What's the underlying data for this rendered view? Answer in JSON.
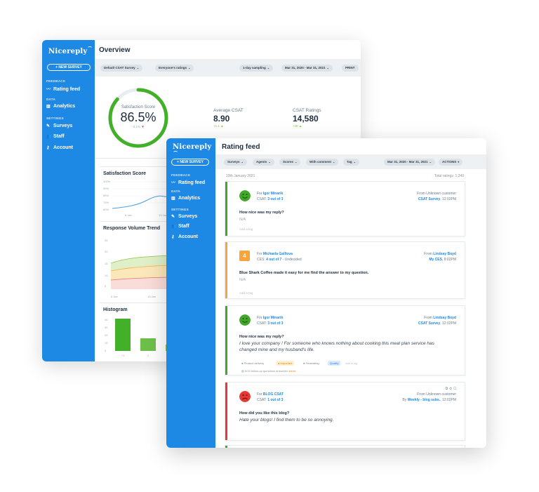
{
  "back": {
    "logo": "Nicereply",
    "new_survey": "+ NEW SURVEY",
    "title": "Overview",
    "sections": {
      "feedback": "FEEDBACK",
      "data": "DATA",
      "settings": "SETTINGS"
    },
    "nav": {
      "rating_feed": "Rating feed",
      "analytics": "Analytics",
      "surveys": "Surveys",
      "staff": "Staff",
      "account": "Account"
    },
    "filters": {
      "survey": "Default CSAT Survey",
      "ratings": "Everyone's ratings",
      "sampling": "1-day sampling",
      "daterange": "Mar 31, 2020 - Mar 31, 2021",
      "print": "PRINT"
    },
    "gauge": {
      "label": "Satisfaction Score",
      "value": "86.5%",
      "delta": "-0.1%",
      "fraction": 0.865
    },
    "kpis": [
      {
        "label": "Average CSAT",
        "value": "8.90",
        "delta": "+1.1"
      },
      {
        "label": "CSAT Ratings",
        "value": "14,580",
        "delta": "+28"
      }
    ],
    "charts": {
      "satisfaction_title": "Satisfaction Score",
      "satisfaction_ticks": [
        "100%",
        "90%",
        "80%",
        "70%",
        "60%"
      ],
      "satisfaction_x": [
        "6 Jan",
        "13 Jan"
      ],
      "volume_title": "Response Volume Trend",
      "volume_ticks": [
        "25",
        "20",
        "15",
        "10",
        "5",
        "0"
      ],
      "volume_x": [
        "6 Jan",
        "13 Jan"
      ],
      "histogram_title": "Histogram",
      "histogram_ticks": [
        "40",
        "30",
        "20",
        "10",
        "0"
      ],
      "histogram_x": [
        "+1",
        "2"
      ]
    }
  },
  "front": {
    "logo": "Nicereply",
    "new_survey": "+ NEW SURVEY",
    "title": "Rating feed",
    "sections": {
      "feedback": "FEEDBACK",
      "data": "DATA",
      "settings": "SETTINGS"
    },
    "nav": {
      "rating_feed": "Rating feed",
      "analytics": "Analytics",
      "surveys": "Surveys",
      "staff": "Staff",
      "account": "Account"
    },
    "filters": {
      "surveys": "Surveys",
      "agents": "Agents",
      "scores": "Scores",
      "with_comment": "With comment",
      "tag": "Tag",
      "daterange": "Mar 31, 2020 - Mar 31, 2021",
      "actions": "ACTIONS"
    },
    "date": "19th January 2021",
    "total": "Total ratings: 1,240",
    "cards": [
      {
        "for_prefix": "For",
        "agent": "Igor Minarik",
        "score_prefix": "CSAT:",
        "score": "3 out of 3",
        "score_suffix": "",
        "from_prefix": "From",
        "from": "Unknown customer",
        "survey": "CSAT Survey",
        "time": "12:02PM",
        "question": "How nice was my reply?",
        "answer": "N/A",
        "add_tag": "Add a tag",
        "color": "#43a82a"
      },
      {
        "for_prefix": "For",
        "agent": "Michaela Galllova",
        "score_prefix": "CES:",
        "score": "4 out of 7",
        "score_suffix": "- Undecided",
        "from_prefix": "From",
        "from": "Lindsay Boyd",
        "survey": "My CES",
        "time": "8:02PM",
        "question": "Blue Shark Coffee made it easy for me find the answer to my question.",
        "answer": "N/A",
        "add_tag": "Add a tag",
        "badge": "4",
        "color": "#f7a43a"
      },
      {
        "for_prefix": "For",
        "agent": "Igor Minarik",
        "score_prefix": "CSAT:",
        "score": "3 out of 3",
        "score_suffix": "",
        "from_prefix": "From",
        "from": "Lindsay Boyd",
        "survey": "CSAT Survey",
        "time": "12:02PM",
        "question": "How nice was my reply?",
        "answer": "I love your company ! For someone who knows nothing about cooking this meal plan service has changed mine and my husband's life.",
        "tags": [
          "Product delivery",
          "Important",
          "Frustrating",
          "Quality",
          "Add a tag"
        ],
        "followup": "5/15 follow-up questions answered",
        "color": "#43a82a"
      },
      {
        "for_prefix": "For",
        "agent": "BLOG CSAT",
        "score_prefix": "CSAT:",
        "score": "1 out of 3",
        "score_suffix": "",
        "from_prefix": "From",
        "from": "Unknown customer",
        "by_prefix": "By",
        "survey": "Weekly - blog subs.",
        "time": "12:02PM",
        "question": "How did you like this blog?",
        "answer": "Hate your blogs! I find them to be so annoying.",
        "color": "#e53935"
      }
    ]
  }
}
